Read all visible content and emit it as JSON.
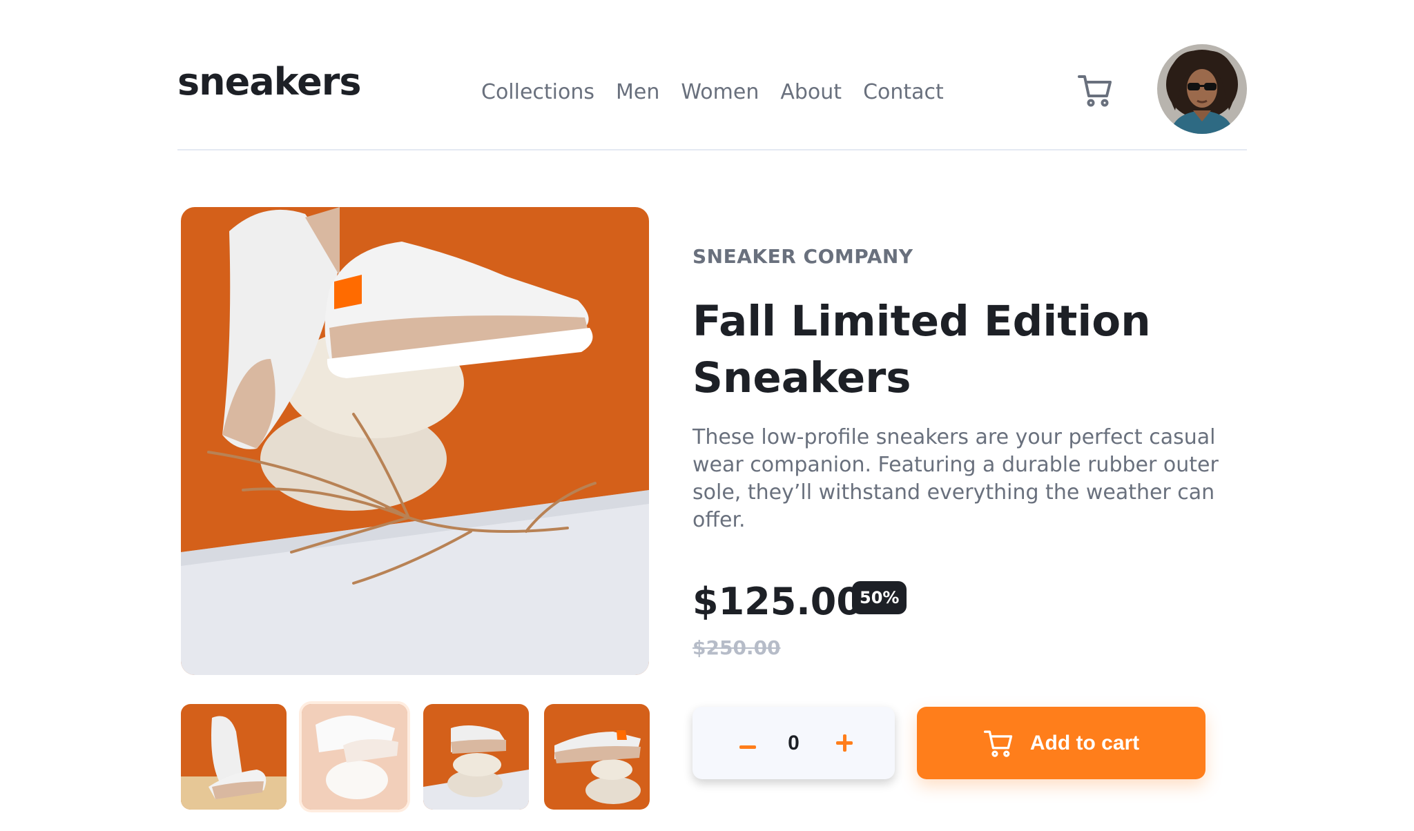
{
  "header": {
    "logo": "sneakers",
    "nav": [
      "Collections",
      "Men",
      "Women",
      "About",
      "Contact"
    ]
  },
  "product": {
    "company": "SNEAKER COMPANY",
    "title": "Fall Limited Edition Sneakers",
    "description": "These low-profile sneakers are your perfect casual wear companion. Featuring a durable rubber outer sole, they’ll withstand everything the weather can offer.",
    "price": "$125.00",
    "discount": "50%",
    "original_price": "$250.00",
    "quantity": "0",
    "add_to_cart": "Add to cart"
  },
  "gallery": {
    "selected_thumbnail": 2,
    "thumbnail_count": 4
  },
  "colors": {
    "accent": "#ff7e1b",
    "dark": "#1d2026",
    "text_muted": "#69707d",
    "pale_orange": "#ffede0"
  },
  "icons": [
    "cart-icon",
    "avatar"
  ]
}
